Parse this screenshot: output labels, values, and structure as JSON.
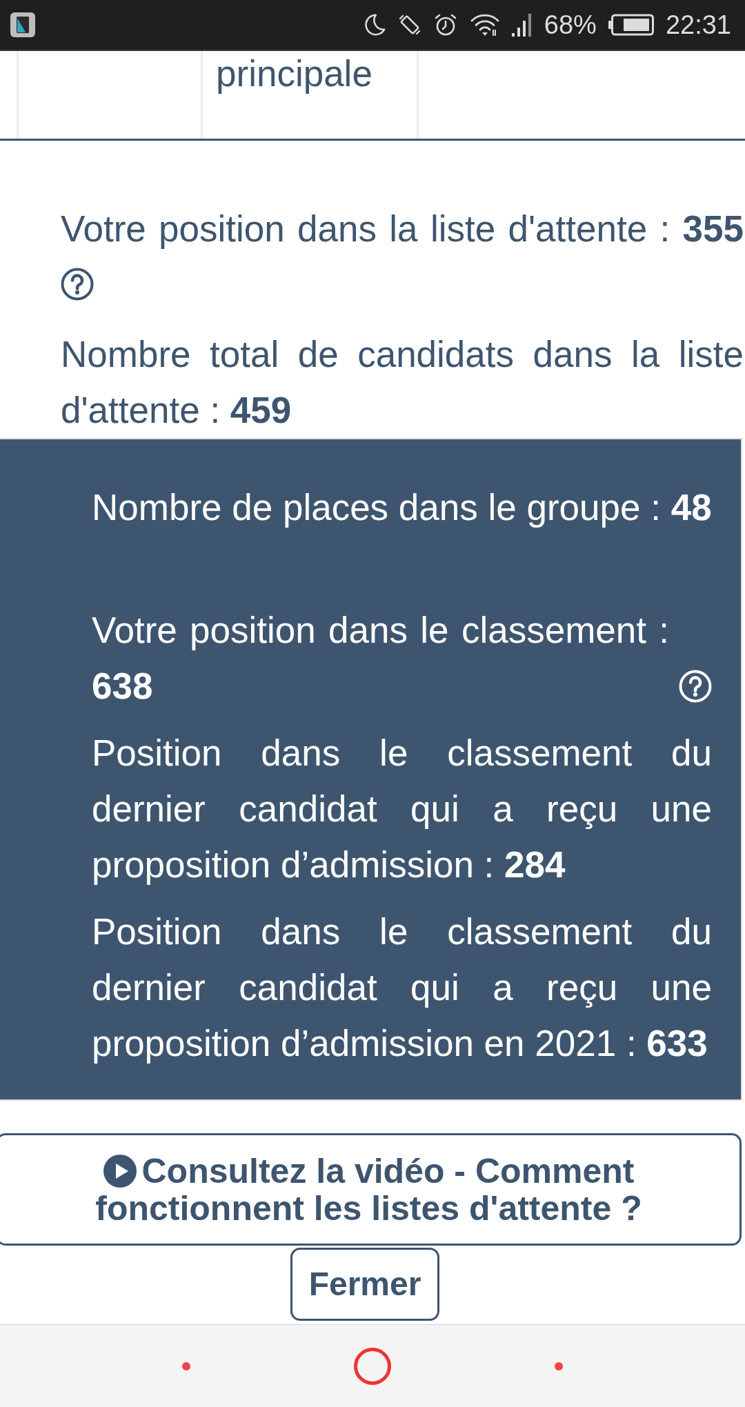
{
  "status_bar": {
    "battery_text": "68%",
    "time": "22:31"
  },
  "table": {
    "rows": [
      {
        "column_2": "principale"
      }
    ]
  },
  "waitlist": {
    "paragraphs": [
      {
        "text": "Votre position dans la liste d'attente : **355**",
        "help_icon": true
      },
      {
        "text": "Nombre total de candidats dans la liste d'attente : **459**",
        "help_icon": false
      }
    ]
  },
  "ranking_panel": {
    "paragraphs": [
      {
        "text": "Nombre de places dans le groupe : **48**",
        "help_icon": false
      },
      {
        "text": "Votre position dans le classement : **638**",
        "help_icon": true
      },
      {
        "text": "Position dans le classement du dernier candidat qui a reçu une proposition d’admission : **284**",
        "help_icon": false
      },
      {
        "text": "Position dans le classement du dernier candidat qui a reçu une proposition d’admission en 2021 : **633**",
        "help_icon": false
      }
    ]
  },
  "video_button": {
    "label": "Consultez la vidéo - Comment fonctionnent les listes d'attente ?"
  },
  "close_button": {
    "label": "Fermer"
  }
}
